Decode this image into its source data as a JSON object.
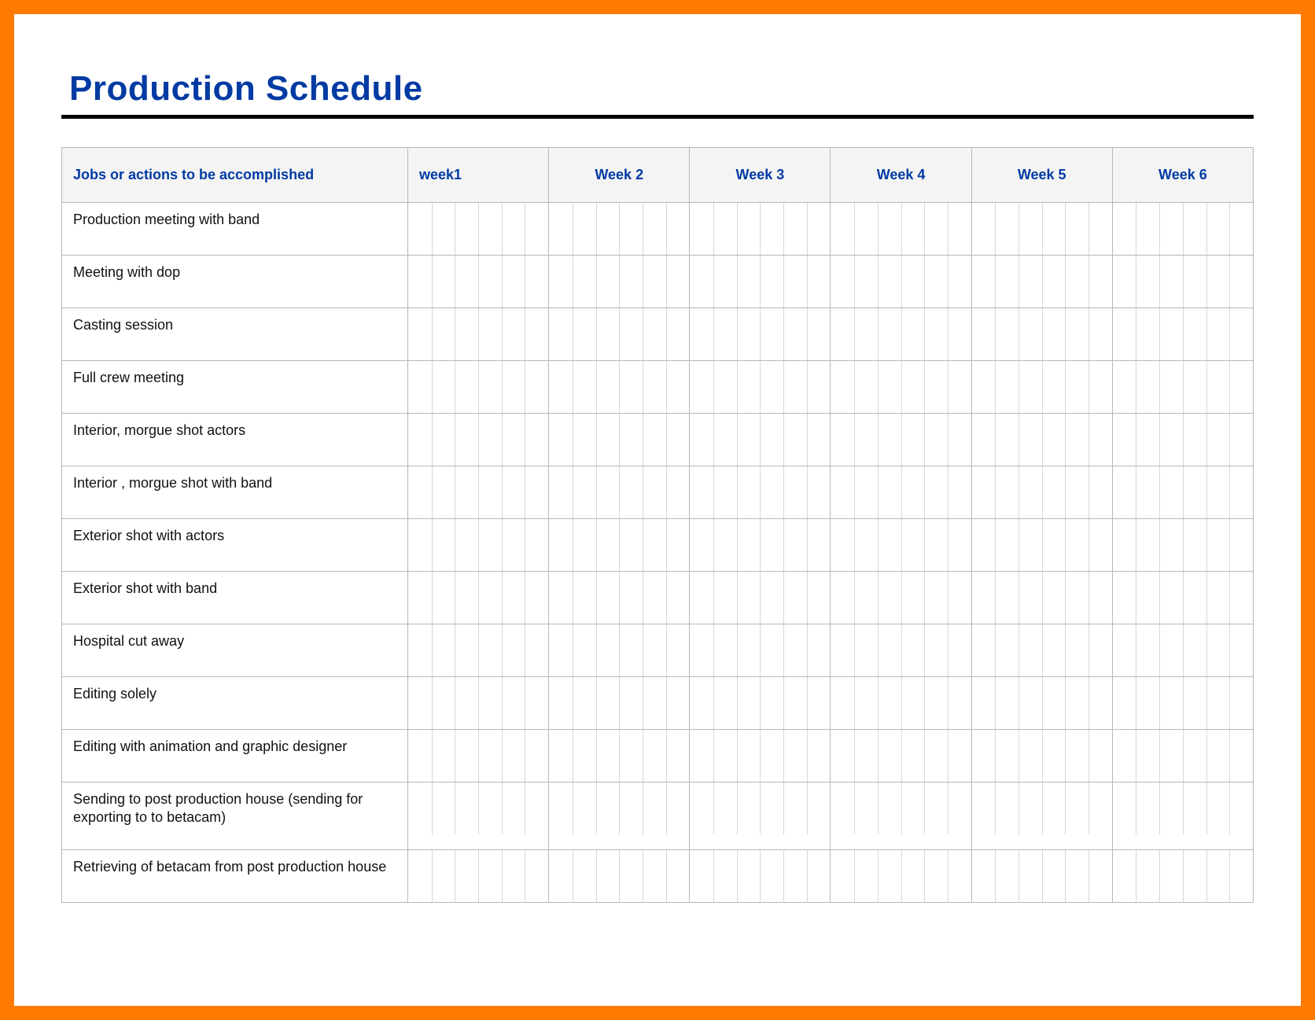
{
  "title": "Production Schedule",
  "colors": {
    "frame": "#ff7a00",
    "heading": "#003aa3",
    "rule": "#000000",
    "grid": "#b8b8b8",
    "subgrid": "#d6d6d6",
    "header_bg": "#f4f4f4"
  },
  "table": {
    "jobs_header": "Jobs or actions to be accomplished",
    "weeks": [
      "week1",
      "Week 2",
      "Week 3",
      "Week 4",
      "Week 5",
      "Week 6"
    ],
    "days_per_week": 6,
    "rows": [
      "Production meeting with band",
      "Meeting with  dop",
      "Casting session",
      "Full crew meeting",
      "Interior, morgue shot actors",
      "Interior , morgue shot with band",
      "Exterior shot with actors",
      "Exterior shot with band",
      "Hospital cut away",
      "Editing solely",
      "Editing with animation and graphic designer",
      "Sending to  post production house (sending for exporting to to betacam)",
      "Retrieving of betacam  from post production house"
    ]
  }
}
